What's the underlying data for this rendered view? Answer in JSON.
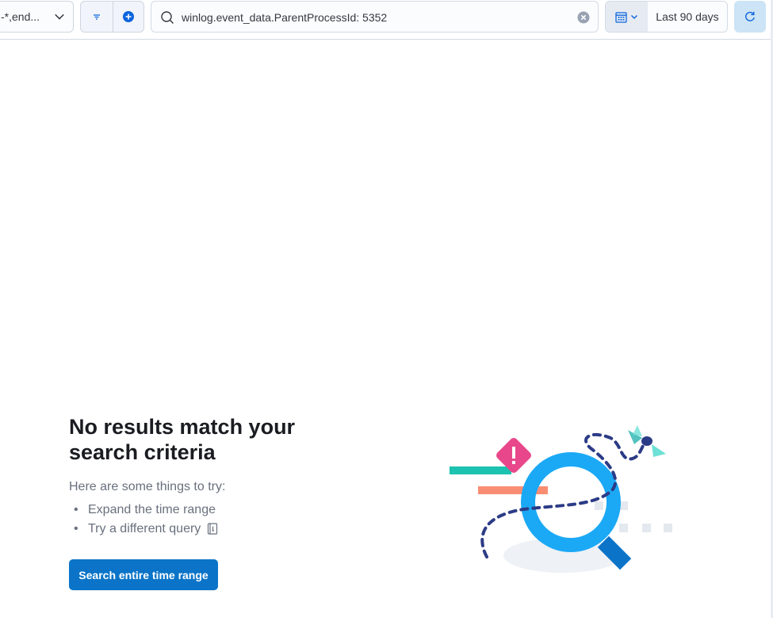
{
  "toolbar": {
    "index_pattern": "-*,end...",
    "search_query": "winlog.event_data.ParentProcessId: 5352",
    "time_range": "Last 90 days",
    "icons": {
      "index_chevron": "chevron-down-icon",
      "filter": "filter-icon",
      "add": "plus-circle-icon",
      "search": "search-icon",
      "clear": "clear-icon",
      "calendar": "calendar-icon",
      "refresh": "refresh-icon"
    }
  },
  "empty_state": {
    "title": "No results match your search criteria",
    "subtitle": "Here are some things to try:",
    "tips": [
      "Expand the time range",
      "Try a different query"
    ],
    "button_label": "Search entire time range"
  },
  "colors": {
    "primary": "#0b74c8",
    "accent_pink": "#e8478b",
    "teal": "#1bc3b0",
    "salmon": "#f98d74",
    "magnifier": "#1ba9f5",
    "navy": "#2c3b86"
  }
}
